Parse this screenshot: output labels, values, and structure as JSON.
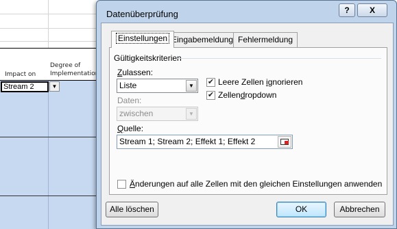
{
  "spreadsheet": {
    "header_impact": "Impact on",
    "header_degree_line1": "Degree of",
    "header_degree_line2": "Implementation",
    "selected_cell_value": "Stream 2",
    "cell_dropdown_icon": "down-triangle",
    "right_column_fragment": "n"
  },
  "dialog": {
    "title": "Datenüberprüfung",
    "help_label": "?",
    "close_label": "X",
    "tabs": [
      {
        "label": "Einstellungen",
        "active": true
      },
      {
        "label": "Eingabemeldung",
        "active": false
      },
      {
        "label": "Fehlermeldung",
        "active": false
      }
    ],
    "group_title": "Gültigkeitskriterien",
    "allow": {
      "label": "Zulassen:",
      "value": "Liste"
    },
    "data": {
      "label": "Daten:",
      "value": "zwischen",
      "disabled": true
    },
    "ignore_blank": {
      "label": "Leere Zellen ignorieren",
      "checked": true
    },
    "in_cell_dropdown": {
      "label": "Zellendropdown",
      "checked": true
    },
    "source": {
      "label": "Quelle:",
      "value": "Stream 1; Stream 2; Effekt 1; Effekt 2",
      "ref_icon": "range-select-icon"
    },
    "apply_all": {
      "label": "Änderungen auf alle Zellen mit den gleichen Einstellungen anwenden",
      "checked": false
    },
    "buttons": {
      "clear_all": "Alle löschen",
      "ok": "OK",
      "cancel": "Abbrechen"
    }
  },
  "colors": {
    "dialog_frame": "#bfd3ea",
    "selection_fill": "#c6d9f1",
    "default_button": "#bee6fd"
  }
}
